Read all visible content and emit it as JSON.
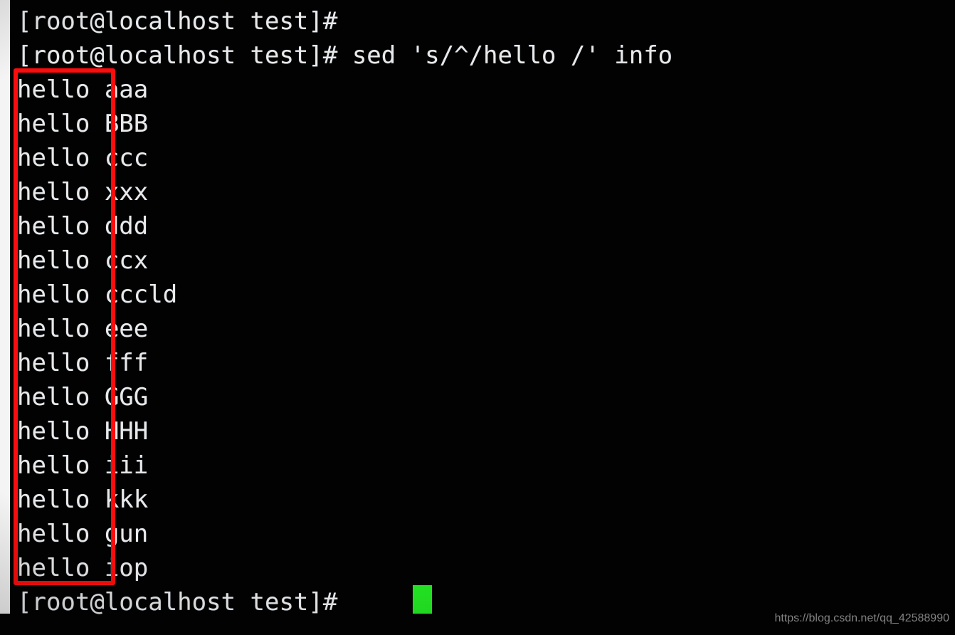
{
  "terminal": {
    "prompt": "[root@localhost test]#",
    "command": "sed 's/^/hello /' info",
    "prefix": "hello ",
    "lines": [
      {
        "type": "prompt",
        "prompt": "[root@localhost test]#",
        "command": ""
      },
      {
        "type": "prompt",
        "prompt": "[root@localhost test]#",
        "command": " sed 's/^/hello /' info"
      },
      {
        "type": "output",
        "prefix": "hello ",
        "value": "aaa"
      },
      {
        "type": "output",
        "prefix": "hello ",
        "value": "BBB"
      },
      {
        "type": "output",
        "prefix": "hello ",
        "value": "ccc"
      },
      {
        "type": "output",
        "prefix": "hello ",
        "value": "xxx"
      },
      {
        "type": "output",
        "prefix": "hello ",
        "value": "ddd"
      },
      {
        "type": "output",
        "prefix": "hello ",
        "value": "ccx"
      },
      {
        "type": "output",
        "prefix": "hello ",
        "value": "cccld"
      },
      {
        "type": "output",
        "prefix": "hello ",
        "value": "eee"
      },
      {
        "type": "output",
        "prefix": "hello ",
        "value": "fff"
      },
      {
        "type": "output",
        "prefix": "hello ",
        "value": "GGG"
      },
      {
        "type": "output",
        "prefix": "hello ",
        "value": "HHH"
      },
      {
        "type": "output",
        "prefix": "hello ",
        "value": "iii"
      },
      {
        "type": "output",
        "prefix": "hello ",
        "value": "kkk"
      },
      {
        "type": "output",
        "prefix": "hello ",
        "value": "gun"
      },
      {
        "type": "output",
        "prefix": "hello ",
        "value": "iop"
      },
      {
        "type": "prompt",
        "prompt": "[root@localhost test]#",
        "command": " "
      }
    ],
    "cursor": {
      "shape": "block",
      "color": "#23e223"
    }
  },
  "annotation": {
    "shape": "rectangle",
    "color": "#fb0d0d",
    "target": "hello-prefix-column"
  },
  "watermark": {
    "text": "https://blog.csdn.net/qq_42588990"
  },
  "colors": {
    "background": "#020202",
    "text": "#e9e9e9",
    "annotation": "#fb0d0d",
    "cursor": "#23e223"
  }
}
